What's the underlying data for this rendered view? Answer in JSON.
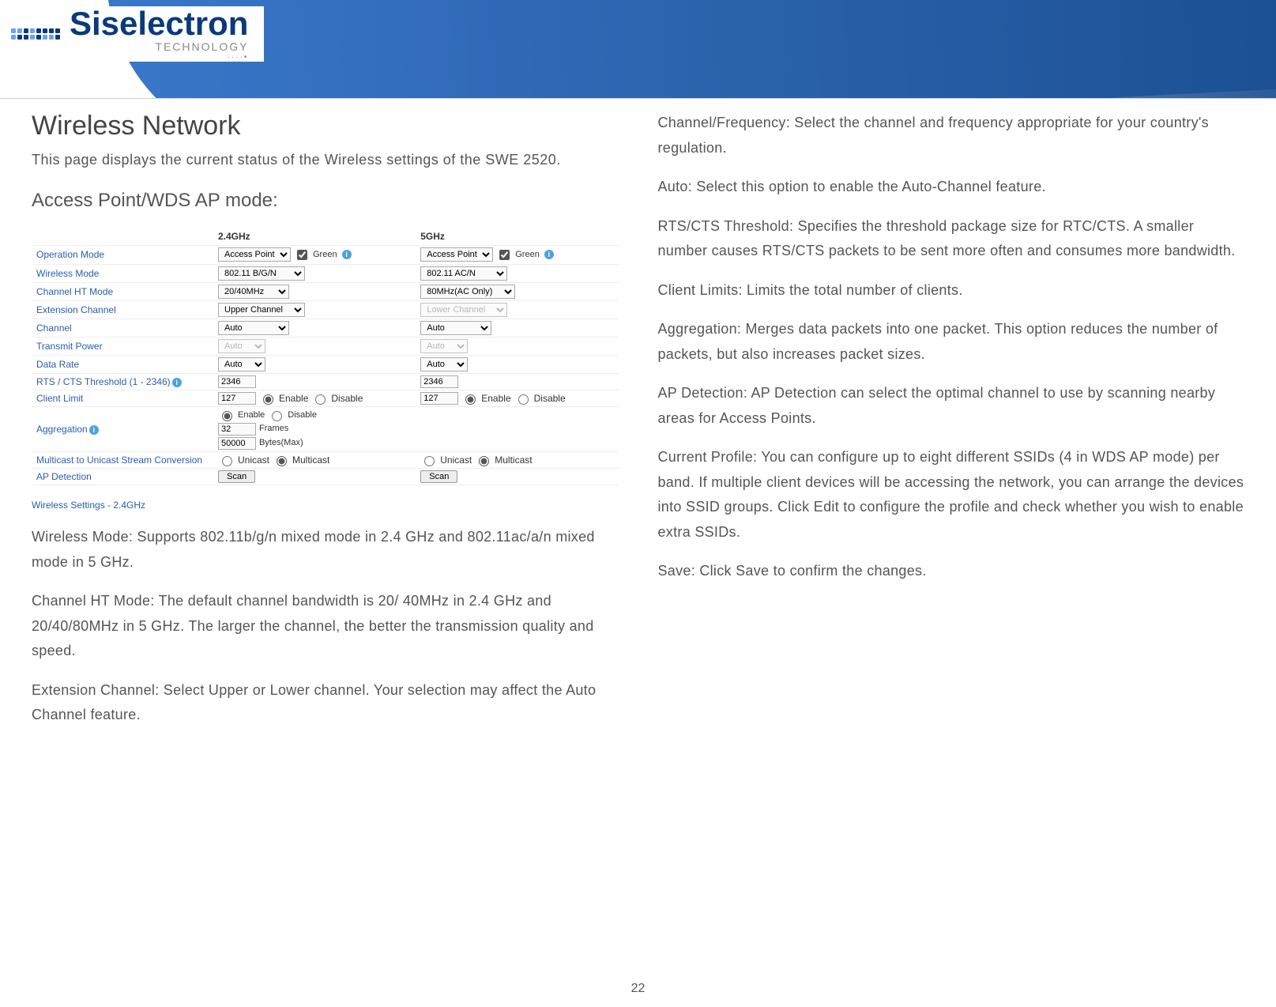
{
  "logo": {
    "brand": "Siselectron",
    "sub": "TECHNOLOGY"
  },
  "left": {
    "h1": "Wireless Network",
    "intro": "This page displays the current status of the Wireless settings of the SWE 2520.",
    "h2": "Access Point/WDS AP mode:",
    "table": {
      "col24": "2.4GHz",
      "col5": "5GHz",
      "rows": {
        "op_mode": {
          "label": "Operation Mode",
          "v24": "Access Point",
          "green24": "Green",
          "v5": "Access Point",
          "green5": "Green"
        },
        "wmode": {
          "label": "Wireless Mode",
          "v24": "802.11 B/G/N",
          "v5": "802.11 AC/N"
        },
        "htmode": {
          "label": "Channel HT Mode",
          "v24": "20/40MHz",
          "v5": "80MHz(AC Only)"
        },
        "ext": {
          "label": "Extension Channel",
          "v24": "Upper Channel",
          "v5": "Lower Channel"
        },
        "chan": {
          "label": "Channel",
          "v24": "Auto",
          "v5": "Auto"
        },
        "tx": {
          "label": "Transmit Power",
          "v24": "Auto",
          "v5": "Auto"
        },
        "rate": {
          "label": "Data Rate",
          "v24": "Auto",
          "v5": "Auto"
        },
        "rts": {
          "label": "RTS / CTS Threshold (1 - 2346)",
          "v24": "2346",
          "v5": "2346"
        },
        "climit": {
          "label": "Client Limit",
          "v24": "127",
          "v5": "127",
          "en": "Enable",
          "dis": "Disable"
        },
        "agg": {
          "label": "Aggregation",
          "en": "Enable",
          "dis": "Disable",
          "frames_v": "32",
          "frames_l": "Frames",
          "bytes_v": "50000",
          "bytes_l": "Bytes(Max)"
        },
        "mcast": {
          "label": "Multicast to Unicast Stream Conversion",
          "uni": "Unicast",
          "multi": "Multicast"
        },
        "apdet": {
          "label": "AP Detection",
          "scan": "Scan"
        }
      }
    },
    "subhead": "Wireless Settings - 2.4GHz",
    "p1": "Wireless Mode: Supports 802.11b/g/n mixed mode in 2.4 GHz and 802.11ac/a/n mixed mode in 5 GHz.",
    "p2": "Channel HT Mode: The default channel bandwidth is 20/ 40MHz in 2.4 GHz and 20/40/80MHz in 5 GHz. The larger the channel, the better the transmission quality and speed.",
    "p3": "Extension Channel: Select Upper or Lower channel. Your selection may affect the Auto Channel feature."
  },
  "right": {
    "p1": "Channel/Frequency: Select the channel and frequency appropriate for your country's regulation.",
    "p2": "Auto: Select this option to enable the Auto-Channel feature.",
    "p3": "RTS/CTS Threshold: Specifies the threshold package size for RTC/CTS. A smaller number causes RTS/CTS packets to be sent more often and consumes more bandwidth.",
    "p4": "Client Limits: Limits the total number of clients.",
    "p5": "Aggregation: Merges data packets into one packet. This option reduces the number of packets, but also increases packet sizes.",
    "p6": "AP Detection: AP Detection can select the optimal channel to use by scanning nearby areas for Access Points.",
    "p7": "Current Profile: You can configure up to eight different SSIDs (4 in WDS AP mode) per band. If multiple client devices will be accessing the network, you can arrange the devices into SSID groups. Click Edit to configure the profile and check whether you wish to enable extra SSIDs.",
    "p8": "Save: Click Save to confirm the changes."
  },
  "page": "22"
}
